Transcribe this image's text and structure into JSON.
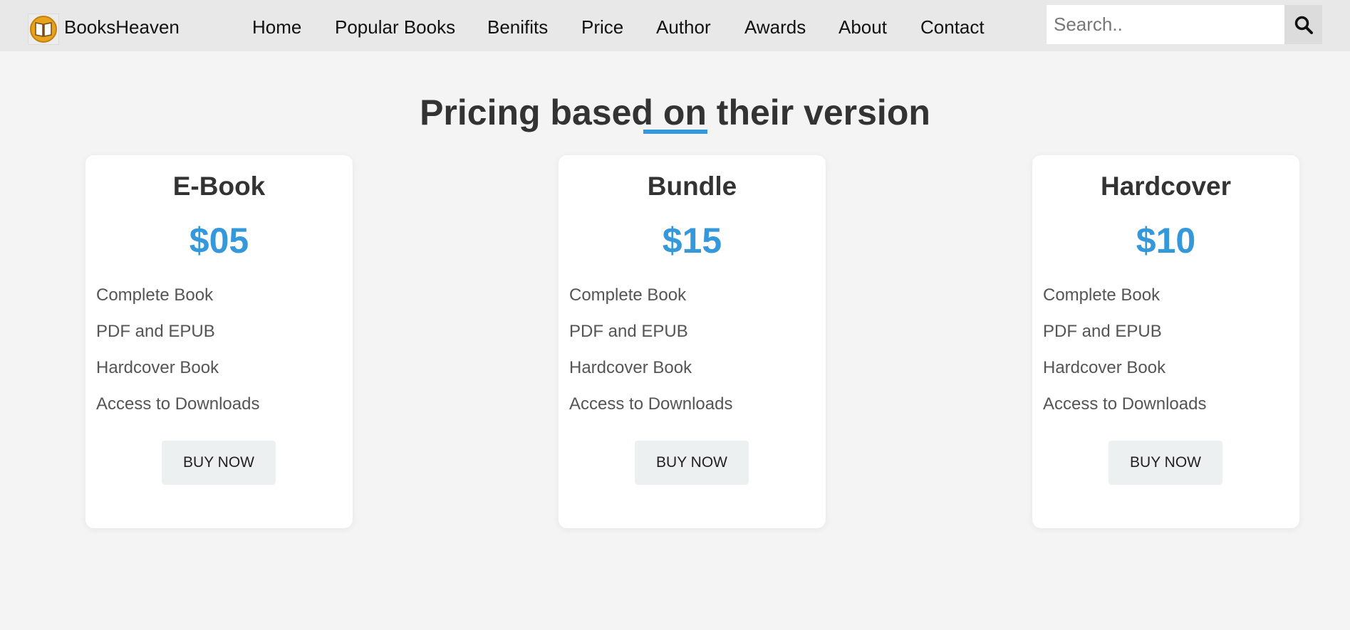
{
  "navbar": {
    "brand": "BooksHeaven",
    "links": [
      "Home",
      "Popular Books",
      "Benifits",
      "Price",
      "Author",
      "Awards",
      "About",
      "Contact"
    ],
    "search_placeholder": "Search.."
  },
  "section": {
    "title": "Pricing based on their version"
  },
  "plans": [
    {
      "name": "E-Book",
      "price": "$05",
      "features": [
        "Complete Book",
        "PDF and EPUB",
        "Hardcover Book",
        "Access to Downloads"
      ],
      "button": "BUY NOW"
    },
    {
      "name": "Bundle",
      "price": "$15",
      "features": [
        "Complete Book",
        "PDF and EPUB",
        "Hardcover Book",
        "Access to Downloads"
      ],
      "button": "BUY NOW"
    },
    {
      "name": "Hardcover",
      "price": "$10",
      "features": [
        "Complete Book",
        "PDF and EPUB",
        "Hardcover Book",
        "Access to Downloads"
      ],
      "button": "BUY NOW"
    }
  ],
  "colors": {
    "accent": "#3498db",
    "page_background": "#f4f4f4",
    "navbar_background": "#e8e8e8",
    "button_background": "#ecf0f1"
  },
  "icons": {
    "logo": "book-logo-icon",
    "search": "search-icon"
  }
}
